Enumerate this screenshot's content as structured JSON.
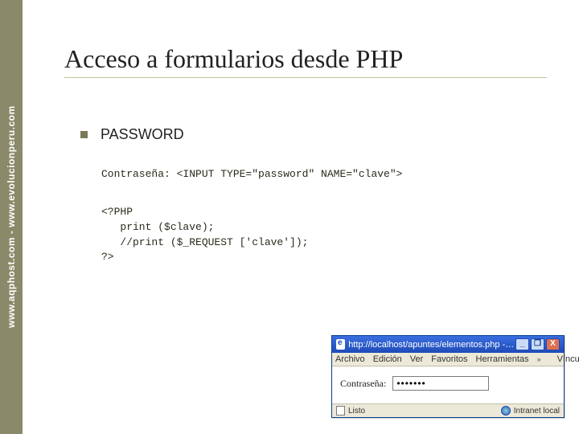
{
  "sidebar": {
    "text": "www.aqphost.com - www.evolucionperu.com"
  },
  "slide": {
    "title": "Acceso a formularios desde PHP",
    "bullet": "PASSWORD",
    "code1": "Contraseña: <INPUT TYPE=\"password\" NAME=\"clave\">",
    "code2": "<?PHP\n   print ($clave);\n   //print ($_REQUEST ['clave']);\n?>"
  },
  "browser": {
    "title": "http://localhost/apuntes/elementos.php - Micros…",
    "menu": {
      "file": "Archivo",
      "edit": "Edición",
      "view": "Ver",
      "fav": "Favoritos",
      "tools": "Herramientas",
      "links": "Vínculos"
    },
    "page": {
      "label": "Contraseña:",
      "masked": "•••••••"
    },
    "status": {
      "done": "Listo",
      "zone": "Intranet local"
    },
    "buttons": {
      "min": "_",
      "max": "❐",
      "close": "X"
    }
  }
}
